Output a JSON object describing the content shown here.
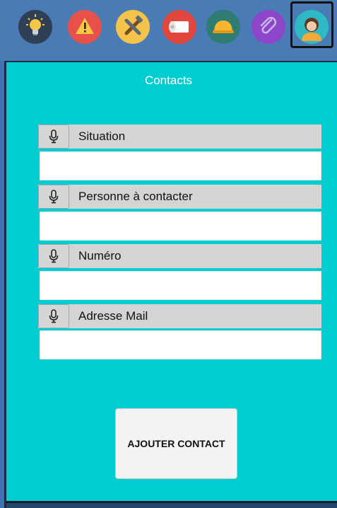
{
  "toolbar": {
    "icons": [
      {
        "name": "lightbulb-icon"
      },
      {
        "name": "warning-icon"
      },
      {
        "name": "tools-icon"
      },
      {
        "name": "paper-roll-icon"
      },
      {
        "name": "hard-hat-icon"
      },
      {
        "name": "paperclip-icon"
      },
      {
        "name": "user-avatar-icon",
        "selected": true
      }
    ]
  },
  "page": {
    "title": "Contacts"
  },
  "form": {
    "fields": [
      {
        "label": "Situation",
        "value": ""
      },
      {
        "label": "Personne à contacter",
        "value": ""
      },
      {
        "label": "Numéro",
        "value": ""
      },
      {
        "label": "Adresse Mail",
        "value": ""
      }
    ],
    "submit_label": "AJOUTER CONTACT"
  },
  "colors": {
    "toolbar_bg": "#4a7bb5",
    "panel_bg": "#00cdd1",
    "label_bg": "#d4d4d4"
  }
}
